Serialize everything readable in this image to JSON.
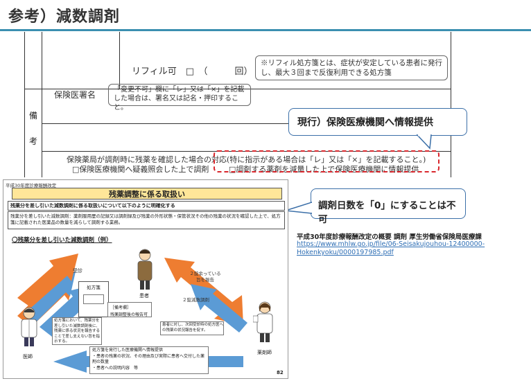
{
  "title": "参考）減数調剤",
  "form": {
    "refill_text": "リフィル可　□　（　　　回）",
    "refill_note": "※リフィル処方箋とは、症状が安定している患者に発行し、最大３回まで反復利用できる処方箋",
    "doctor_sign_label": "保険医署名",
    "doctor_sign_note": "「変更不可」欄に「レ」又は「×」を記載した場合は、署名又は記名・押印すること。",
    "remarks_char1": "備",
    "remarks_char2": "考",
    "pharmacy_line1": "保険薬局が調剤時に残薬を確認した場合の対応(特に指示がある場合は「レ」又は「×」を記載すること。)",
    "pharmacy_opt1": "□保険医療機関へ疑義照会した上で調剤",
    "pharmacy_opt2": "□調剤する薬剤を減量した上で保険医療機関に情報提供"
  },
  "callouts": {
    "current": "現行）保険医療機関へ情報提供",
    "days_zero": "調剤日数を「0」にすることは不可"
  },
  "source": {
    "line1": "平成30年度診療報酬改定の概要 調剤 厚生労働省保険局医療課",
    "url_line1": "https://www.mhlw.go.jp/file/06-Seisakujouhou-12400000-",
    "url_line2": "Hokenkyoku/0000197985.pdf"
  },
  "slide": {
    "tag": "平成30年度診療報酬改定",
    "heading": "残薬調整に係る取扱い",
    "summary": "残薬分を差し引いた減数調剤に係る取扱いについて以下のように明確化する",
    "detail": "残薬分を差し引いた減数調剤：薬剤服用歴の記録又は調剤録及び残薬の外形状態・保管状況その他の残薬の状況を確認した上で、処方箋に記載された医薬品の数量を減らして調剤する業務。",
    "example_title": "〇残薬分を差し引いた減数調剤（例）",
    "arrow_visit": "受診",
    "arrow_report": "２錠余っている旨を報告",
    "arrow_reduce": "２錠減数調剤",
    "rx_label": "処方箋",
    "remarks_label": "［備考欄］",
    "remarks_check": "残薬調整後の報告可",
    "patient_label": "患者",
    "doctor_label": "医師",
    "pharmacist_label": "薬剤師",
    "doctor_note": "処方箋において、残薬分を差し引いた減数調剤後に、残薬に係る状況を報告することで差し支えない旨を指示する。",
    "pharmacist_note": "患者に対し、次回受診時の処方医への残薬の状況報告を促す。",
    "feedback_note": "処方箋を発行した医療機関へ情報提供\n・患者の残薬の状況、その理由及び実際に患者へ交付した薬剤の数量\n・患者への説明内容　等",
    "page_number": "82"
  },
  "colors": {
    "accent_blue": "#3a8fb0",
    "arrow_orange": "#ee7d31",
    "arrow_blue": "#5b9bd5",
    "heading_yellow": "#ffe699",
    "dashed_red": "#d9262c",
    "link_blue": "#2f6fb5"
  }
}
